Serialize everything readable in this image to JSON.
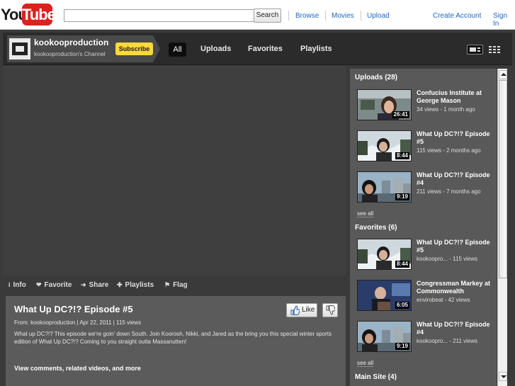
{
  "header": {
    "logo_you": "You",
    "logo_tube": "Tube",
    "search_placeholder": "",
    "search_button": "Search",
    "nav": [
      "Browse",
      "Movies",
      "Upload"
    ],
    "create_account": "Create Account",
    "sign_in": "Sign In"
  },
  "channel": {
    "name": "kookooproduction",
    "subtitle": "kookooproduction's Channel",
    "subscribe_label": "Subscribe",
    "tabs": [
      "All",
      "Uploads",
      "Favorites",
      "Playlists"
    ],
    "active_tab": "All"
  },
  "actions": [
    {
      "label": "Info",
      "icon": "info-icon",
      "glyph": "i"
    },
    {
      "label": "Favorite",
      "icon": "heart-icon",
      "glyph": "❤"
    },
    {
      "label": "Share",
      "icon": "share-arrow-icon",
      "glyph": "➜"
    },
    {
      "label": "Playlists",
      "icon": "plus-icon",
      "glyph": "✚"
    },
    {
      "label": "Flag",
      "icon": "flag-icon",
      "glyph": "⚑"
    }
  ],
  "video": {
    "title": "What Up DC?!? Episode #5",
    "meta": "From: kookooproduction  | Apr 22, 2011  | 115 views",
    "description": "What up DC?!? This episode we're goin' down South. Join Koorosh, Nikki, and Jared as the bring you this special winter sports edition of What Up DC?!? Coming to you straight outta Massanutten!",
    "more_link": "View comments, related videos, and more",
    "like_label": "Like"
  },
  "sidebar": {
    "uploads_title": "Uploads (28)",
    "uploads": [
      {
        "title": "Confucius Institute at George Mason",
        "meta": "34 views - 1 month ago",
        "duration": "26:41",
        "thumb": "interview"
      },
      {
        "title": "What Up DC?!? Episode #5",
        "meta": "115 views - 2 months ago",
        "duration": "8:44",
        "thumb": "snow"
      },
      {
        "title": "What Up DC?!? Episode #4",
        "meta": "211 views - 7 months ago",
        "duration": "9:19",
        "thumb": "city"
      }
    ],
    "see_all_1": "see all",
    "favorites_title": "Favorites (6)",
    "favorites": [
      {
        "title": "What Up DC?!? Episode #5",
        "meta": "kookoopro... - 115 views",
        "duration": "8:44",
        "thumb": "snow"
      },
      {
        "title": "Congressman Markey at Commonwealth",
        "meta": "envirobeat - 42 views",
        "duration": "6:05",
        "thumb": "podium"
      },
      {
        "title": "What Up DC?!? Episode #4",
        "meta": "kookoopro... - 211 views",
        "duration": "9:19",
        "thumb": "city"
      }
    ],
    "see_all_2": "see all",
    "main_site_title": "Main Site (4)"
  }
}
